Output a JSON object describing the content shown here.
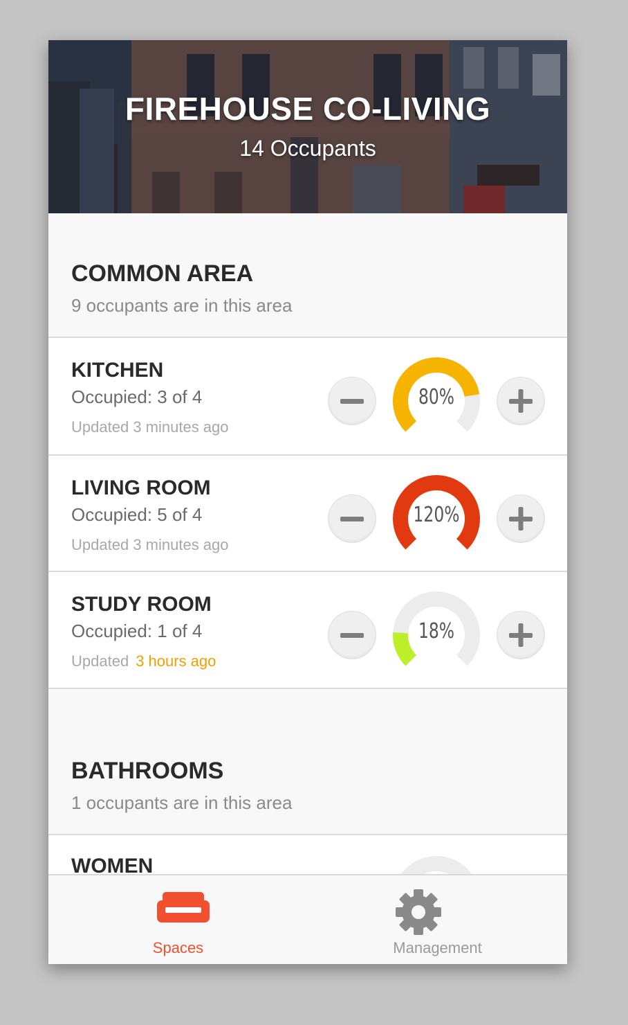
{
  "header": {
    "title": "FIREHOUSE CO-LIVING",
    "subtitle": "14 Occupants"
  },
  "sections": [
    {
      "title": "COMMON AREA",
      "desc": "9 occupants are in this area",
      "rooms": [
        {
          "name": "KITCHEN",
          "occupancy": "Occupied: 3 of 4",
          "updated_prefix": "Updated",
          "updated_time": "3 minutes ago",
          "stale": false,
          "percent_label": "80%",
          "percent": 80,
          "color": "#f6b400"
        },
        {
          "name": "LIVING ROOM",
          "occupancy": "Occupied: 5 of 4",
          "updated_prefix": "Updated",
          "updated_time": "3 minutes ago",
          "stale": false,
          "percent_label": "120%",
          "percent": 120,
          "color": "#e23a10"
        },
        {
          "name": "STUDY ROOM",
          "occupancy": "Occupied: 1 of 4",
          "updated_prefix": "Updated",
          "updated_time": "3 hours ago",
          "stale": true,
          "percent_label": "18%",
          "percent": 18,
          "color": "#bdf02a"
        }
      ]
    },
    {
      "title": "BATHROOMS",
      "desc": "1 occupants are in this area",
      "rooms": [
        {
          "name": "WOMEN"
        }
      ]
    }
  ],
  "controls": {
    "minus_icon": "minus-icon",
    "plus_icon": "plus-icon"
  },
  "tabs": [
    {
      "label": "Spaces",
      "icon": "sofa-icon",
      "active": true,
      "color": "#f05030"
    },
    {
      "label": "Management",
      "icon": "gear-icon",
      "active": false,
      "color": "#8a8a8a"
    }
  ],
  "colors": {
    "gauge_track": "#ececec",
    "stale_text": "#f0a000",
    "accent": "#f05030"
  }
}
